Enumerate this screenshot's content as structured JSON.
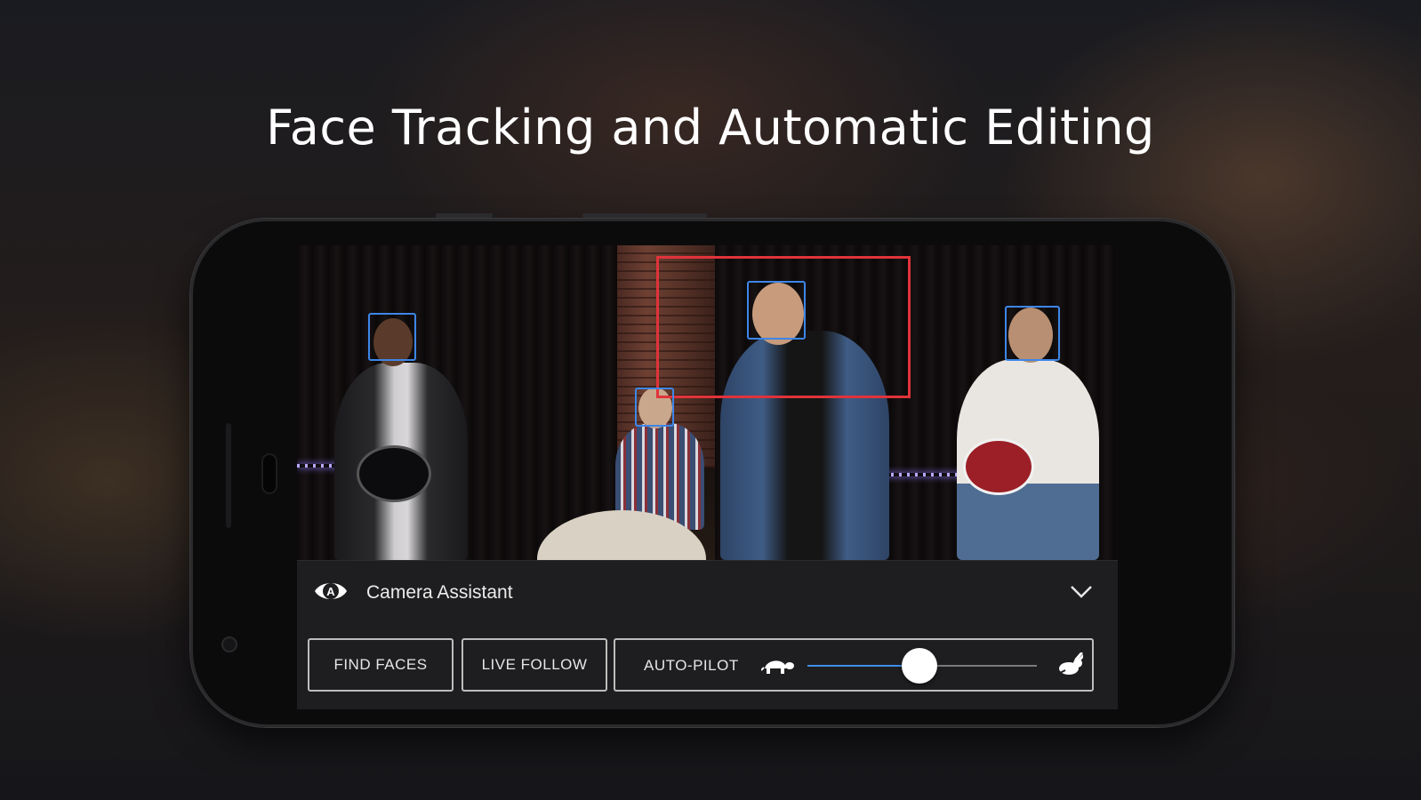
{
  "headline": "Face Tracking and Automatic Editing",
  "assistant": {
    "title": "Camera Assistant",
    "icon": "eye-a-icon",
    "expand_icon": "chevron-down-icon"
  },
  "controls": {
    "find_faces_label": "FIND FACES",
    "live_follow_label": "LIVE FOLLOW",
    "autopilot_label": "AUTO-PILOT",
    "slow_icon": "turtle-icon",
    "fast_icon": "rabbit-icon",
    "speed_level": 0.49
  },
  "colors": {
    "face_box": "#3d86e8",
    "focus_box": "#e0333a",
    "slider_active": "#3f8ee9"
  }
}
